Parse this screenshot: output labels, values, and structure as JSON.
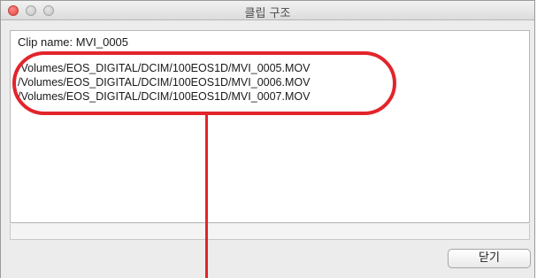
{
  "window": {
    "title": "클립 구조"
  },
  "content": {
    "clip_name": "Clip name: MVI_0005",
    "paths": [
      "/Volumes/EOS_DIGITAL/DCIM/100EOS1D/MVI_0005.MOV",
      "/Volumes/EOS_DIGITAL/DCIM/100EOS1D/MVI_0006.MOV",
      "/Volumes/EOS_DIGITAL/DCIM/100EOS1D/MVI_0007.MOV"
    ]
  },
  "buttons": {
    "close_label": "닫기"
  },
  "colors": {
    "annotation": "#e3242b"
  }
}
